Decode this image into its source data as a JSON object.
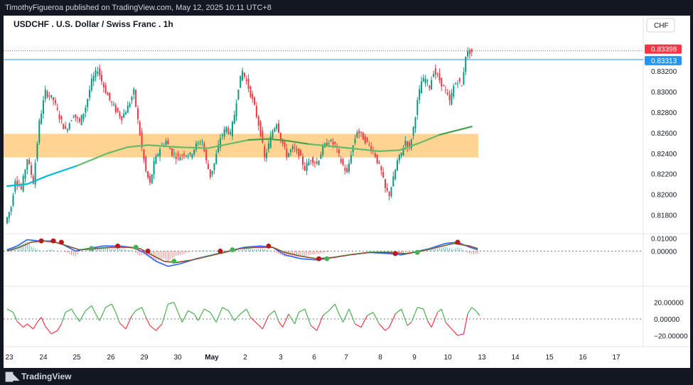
{
  "header": {
    "publisher_line": "TimothyFigueroa published on TradingView.com, May 12, 2025 10:11 UTC+8"
  },
  "footer": {
    "brand": "TradingView",
    "logo_icon": "tradingview-logo-icon"
  },
  "chart_data": [
    {
      "type": "candlestick",
      "title": "USDCHF . U.S. Dollar / Swiss Franc . 1h",
      "currency_button": "CHF",
      "y_ticks": [
        "0.83200",
        "0.83000",
        "0.82800",
        "0.82600",
        "0.82400",
        "0.82200",
        "0.82000",
        "0.81800"
      ],
      "ylim": [
        0.8163,
        0.8352
      ],
      "x_ticks": [
        "23",
        "24",
        "25",
        "26",
        "29",
        "30",
        "May",
        "2",
        "3",
        "6",
        "7",
        "8",
        "9",
        "10",
        "13",
        "14",
        "15",
        "16",
        "17"
      ],
      "price_labels": [
        {
          "text": "0.83398",
          "value": 0.83398,
          "color": "#f23645"
        },
        {
          "text": "0.83313",
          "value": 0.83313,
          "color": "#2196f3"
        }
      ],
      "zone": {
        "from": 0.8236,
        "to": 0.8259,
        "color": "#ffcc80"
      },
      "close_path": [
        [
          0,
          0.8172
        ],
        [
          3,
          0.8188
        ],
        [
          5,
          0.8215
        ],
        [
          8,
          0.8205
        ],
        [
          11,
          0.8235
        ],
        [
          14,
          0.8212
        ],
        [
          17,
          0.827
        ],
        [
          20,
          0.83
        ],
        [
          24,
          0.8292
        ],
        [
          27,
          0.8275
        ],
        [
          30,
          0.8262
        ],
        [
          34,
          0.8278
        ],
        [
          37,
          0.827
        ],
        [
          40,
          0.8285
        ],
        [
          43,
          0.831
        ],
        [
          46,
          0.8322
        ],
        [
          49,
          0.8305
        ],
        [
          52,
          0.8292
        ],
        [
          55,
          0.8282
        ],
        [
          58,
          0.8275
        ],
        [
          61,
          0.8285
        ],
        [
          64,
          0.83
        ],
        [
          66,
          0.8272
        ],
        [
          68,
          0.8245
        ],
        [
          70,
          0.8222
        ],
        [
          72,
          0.821
        ],
        [
          74,
          0.823
        ],
        [
          77,
          0.8245
        ],
        [
          80,
          0.8252
        ],
        [
          83,
          0.824
        ],
        [
          86,
          0.8236
        ],
        [
          89,
          0.824
        ],
        [
          92,
          0.8238
        ],
        [
          95,
          0.8248
        ],
        [
          98,
          0.8252
        ],
        [
          100,
          0.8232
        ],
        [
          102,
          0.8218
        ],
        [
          104,
          0.823
        ],
        [
          107,
          0.8255
        ],
        [
          110,
          0.8265
        ],
        [
          112,
          0.8258
        ],
        [
          114,
          0.8278
        ],
        [
          116,
          0.8305
        ],
        [
          118,
          0.832
        ],
        [
          120,
          0.831
        ],
        [
          122,
          0.8298
        ],
        [
          124,
          0.8285
        ],
        [
          127,
          0.826
        ],
        [
          129,
          0.8235
        ],
        [
          131,
          0.8248
        ],
        [
          133,
          0.8262
        ],
        [
          135,
          0.827
        ],
        [
          137,
          0.8255
        ],
        [
          140,
          0.8238
        ],
        [
          143,
          0.8245
        ],
        [
          146,
          0.824
        ],
        [
          149,
          0.8225
        ],
        [
          152,
          0.8235
        ],
        [
          155,
          0.823
        ],
        [
          158,
          0.8245
        ],
        [
          161,
          0.8252
        ],
        [
          164,
          0.8248
        ],
        [
          167,
          0.8232
        ],
        [
          170,
          0.822
        ],
        [
          172,
          0.824
        ],
        [
          175,
          0.8262
        ],
        [
          178,
          0.8255
        ],
        [
          181,
          0.8248
        ],
        [
          184,
          0.8238
        ],
        [
          187,
          0.8222
        ],
        [
          189,
          0.8205
        ],
        [
          191,
          0.82
        ],
        [
          193,
          0.8215
        ],
        [
          195,
          0.8232
        ],
        [
          197,
          0.824
        ],
        [
          199,
          0.8252
        ],
        [
          201,
          0.8245
        ],
        [
          203,
          0.8265
        ],
        [
          205,
          0.829
        ],
        [
          207,
          0.831
        ],
        [
          209,
          0.8312
        ],
        [
          211,
          0.8305
        ],
        [
          213,
          0.832
        ],
        [
          215,
          0.8315
        ],
        [
          217,
          0.8308
        ],
        [
          219,
          0.83
        ],
        [
          221,
          0.829
        ],
        [
          223,
          0.8305
        ],
        [
          225,
          0.8311
        ],
        [
          227,
          0.8305
        ],
        [
          229,
          0.8336
        ],
        [
          231,
          0.8339
        ]
      ],
      "ema_path": [
        [
          0,
          0.8208
        ],
        [
          10,
          0.821
        ],
        [
          20,
          0.8218
        ],
        [
          35,
          0.8228
        ],
        [
          50,
          0.824
        ],
        [
          60,
          0.8246
        ],
        [
          70,
          0.8248
        ],
        [
          85,
          0.8246
        ],
        [
          100,
          0.8245
        ],
        [
          110,
          0.8249
        ],
        [
          120,
          0.8253
        ],
        [
          130,
          0.8254
        ],
        [
          140,
          0.8252
        ],
        [
          150,
          0.8249
        ],
        [
          165,
          0.8246
        ],
        [
          175,
          0.8244
        ],
        [
          185,
          0.8242
        ],
        [
          195,
          0.8243
        ],
        [
          205,
          0.825
        ],
        [
          215,
          0.8258
        ],
        [
          225,
          0.8263
        ],
        [
          231,
          0.8266
        ]
      ],
      "macd": {
        "y_ticks": [
          "0.01000",
          "0.00000"
        ],
        "ylim": [
          -0.0026,
          0.0012
        ],
        "macd_line": [
          [
            0,
            0.0001
          ],
          [
            5,
            0.0004
          ],
          [
            10,
            0.0009
          ],
          [
            16,
            0.0008
          ],
          [
            22,
            0.0008
          ],
          [
            28,
            0.0005
          ],
          [
            34,
            0.0
          ],
          [
            40,
            0.0002
          ],
          [
            48,
            0.0004
          ],
          [
            56,
            0.0004
          ],
          [
            62,
            0.0003
          ],
          [
            68,
            -0.0001
          ],
          [
            74,
            -0.0008
          ],
          [
            80,
            -0.0012
          ],
          [
            86,
            -0.001
          ],
          [
            94,
            -0.0006
          ],
          [
            102,
            -0.0003
          ],
          [
            110,
            0.0
          ],
          [
            118,
            0.0003
          ],
          [
            126,
            0.0004
          ],
          [
            132,
            0.0003
          ],
          [
            138,
            -0.0003
          ],
          [
            146,
            -0.0006
          ],
          [
            154,
            -0.0007
          ],
          [
            162,
            -0.0005
          ],
          [
            170,
            -0.0003
          ],
          [
            180,
            -0.0001
          ],
          [
            190,
            -0.0002
          ],
          [
            196,
            -0.0003
          ],
          [
            202,
            -0.0001
          ],
          [
            210,
            0.0002
          ],
          [
            218,
            0.0006
          ],
          [
            224,
            0.0007
          ],
          [
            230,
            0.0003
          ],
          [
            234,
            0.0001
          ]
        ],
        "signal_line": [
          [
            0,
            0.0
          ],
          [
            6,
            0.0003
          ],
          [
            12,
            0.0007
          ],
          [
            18,
            0.0008
          ],
          [
            24,
            0.0007
          ],
          [
            30,
            0.0004
          ],
          [
            36,
            0.0001
          ],
          [
            44,
            0.0002
          ],
          [
            52,
            0.0003
          ],
          [
            60,
            0.0003
          ],
          [
            66,
            0.0002
          ],
          [
            72,
            -0.0003
          ],
          [
            78,
            -0.0008
          ],
          [
            84,
            -0.0009
          ],
          [
            92,
            -0.0007
          ],
          [
            100,
            -0.0004
          ],
          [
            108,
            -0.0001
          ],
          [
            116,
            0.0002
          ],
          [
            124,
            0.0003
          ],
          [
            132,
            0.0003
          ],
          [
            138,
            -0.0001
          ],
          [
            146,
            -0.0004
          ],
          [
            154,
            -0.0006
          ],
          [
            162,
            -0.0005
          ],
          [
            170,
            -0.0003
          ],
          [
            180,
            -0.0001
          ],
          [
            190,
            -0.0001
          ],
          [
            198,
            -0.0002
          ],
          [
            206,
            0.0
          ],
          [
            214,
            0.0003
          ],
          [
            222,
            0.0006
          ],
          [
            230,
            0.0004
          ],
          [
            234,
            0.0002
          ]
        ],
        "cross_dots": [
          {
            "x": 17,
            "y": 0.0008,
            "color": "#b71c1c"
          },
          {
            "x": 23,
            "y": 0.0008,
            "color": "#b71c1c"
          },
          {
            "x": 27,
            "y": 0.0007,
            "color": "#b71c1c"
          },
          {
            "x": 42,
            "y": 0.0002,
            "color": "#4caf50"
          },
          {
            "x": 55,
            "y": 0.0004,
            "color": "#b71c1c"
          },
          {
            "x": 64,
            "y": 0.0003,
            "color": "#4caf50"
          },
          {
            "x": 70,
            "y": 0.0,
            "color": "#b71c1c"
          },
          {
            "x": 83,
            "y": -0.0008,
            "color": "#4caf50"
          },
          {
            "x": 106,
            "y": 0.0,
            "color": "#b71c1c"
          },
          {
            "x": 112,
            "y": 0.0001,
            "color": "#4caf50"
          },
          {
            "x": 130,
            "y": 0.0004,
            "color": "#b71c1c"
          },
          {
            "x": 155,
            "y": -0.0006,
            "color": "#b71c1c"
          },
          {
            "x": 159,
            "y": -0.0006,
            "color": "#4caf50"
          },
          {
            "x": 193,
            "y": -0.0002,
            "color": "#b71c1c"
          },
          {
            "x": 204,
            "y": -0.0001,
            "color": "#4caf50"
          },
          {
            "x": 224,
            "y": 0.0007,
            "color": "#b71c1c"
          }
        ]
      },
      "oscillator": {
        "y_ticks": [
          "20.00000",
          "0.00000",
          "−20.00000"
        ],
        "ylim": [
          -30,
          30
        ],
        "series": [
          [
            0,
            12
          ],
          [
            3,
            8
          ],
          [
            5,
            -3
          ],
          [
            8,
            -10
          ],
          [
            10,
            -6
          ],
          [
            13,
            -12
          ],
          [
            15,
            -4
          ],
          [
            17,
            2
          ],
          [
            19,
            -9
          ],
          [
            22,
            -18
          ],
          [
            25,
            -14
          ],
          [
            27,
            -6
          ],
          [
            29,
            8
          ],
          [
            32,
            12
          ],
          [
            34,
            4
          ],
          [
            36,
            -3
          ],
          [
            39,
            10
          ],
          [
            42,
            16
          ],
          [
            44,
            6
          ],
          [
            46,
            -2
          ],
          [
            49,
            14
          ],
          [
            52,
            18
          ],
          [
            54,
            8
          ],
          [
            56,
            -5
          ],
          [
            59,
            -12
          ],
          [
            62,
            4
          ],
          [
            64,
            10
          ],
          [
            67,
            14
          ],
          [
            69,
            2
          ],
          [
            71,
            -8
          ],
          [
            74,
            -14
          ],
          [
            77,
            -6
          ],
          [
            80,
            18
          ],
          [
            83,
            20
          ],
          [
            85,
            8
          ],
          [
            87,
            -4
          ],
          [
            90,
            10
          ],
          [
            93,
            6
          ],
          [
            95,
            -2
          ],
          [
            98,
            12
          ],
          [
            101,
            8
          ],
          [
            104,
            -4
          ],
          [
            107,
            14
          ],
          [
            110,
            10
          ],
          [
            113,
            -2
          ],
          [
            116,
            6
          ],
          [
            119,
            12
          ],
          [
            121,
            2
          ],
          [
            124,
            -5
          ],
          [
            127,
            -12
          ],
          [
            130,
            4
          ],
          [
            133,
            10
          ],
          [
            135,
            -3
          ],
          [
            137,
            -10
          ],
          [
            140,
            6
          ],
          [
            143,
            -6
          ],
          [
            145,
            8
          ],
          [
            148,
            12
          ],
          [
            151,
            -8
          ],
          [
            154,
            -14
          ],
          [
            157,
            4
          ],
          [
            160,
            10
          ],
          [
            163,
            18
          ],
          [
            165,
            6
          ],
          [
            167,
            -4
          ],
          [
            170,
            12
          ],
          [
            173,
            -6
          ],
          [
            176,
            -10
          ],
          [
            179,
            4
          ],
          [
            182,
            8
          ],
          [
            185,
            -6
          ],
          [
            188,
            -14
          ],
          [
            190,
            -10
          ],
          [
            193,
            6
          ],
          [
            196,
            12
          ],
          [
            199,
            -8
          ],
          [
            201,
            -4
          ],
          [
            204,
            14
          ],
          [
            207,
            12
          ],
          [
            209,
            -2
          ],
          [
            211,
            -10
          ],
          [
            214,
            8
          ],
          [
            216,
            12
          ],
          [
            218,
            -4
          ],
          [
            221,
            -12
          ],
          [
            224,
            -20
          ],
          [
            227,
            -18
          ],
          [
            229,
            6
          ],
          [
            231,
            14
          ],
          [
            233,
            10
          ],
          [
            235,
            4
          ]
        ]
      }
    }
  ]
}
